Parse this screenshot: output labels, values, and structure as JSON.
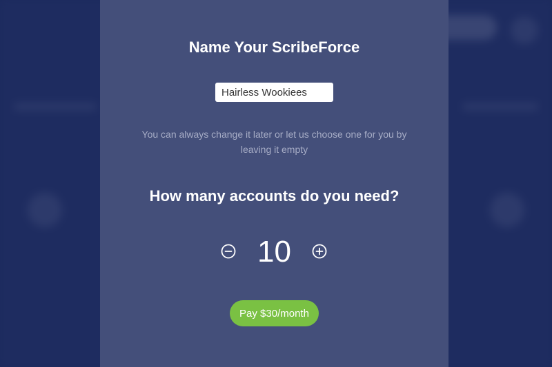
{
  "dialog": {
    "title": "Name Your ScribeForce",
    "name_input": {
      "value": "Hairless Wookiees",
      "placeholder": ""
    },
    "hint": "You can always change it later or let us choose one for you by leaving it empty",
    "accounts_question": "How many accounts do you need?",
    "account_count": "10",
    "decrement_icon": "minus-circle-icon",
    "increment_icon": "plus-circle-icon",
    "pay_button_label": "Pay $30/month"
  },
  "colors": {
    "background": "#1d2b5e",
    "modal": "#444f7a",
    "pay_button": "#7ac143",
    "hint_text": "#a7adc6"
  }
}
